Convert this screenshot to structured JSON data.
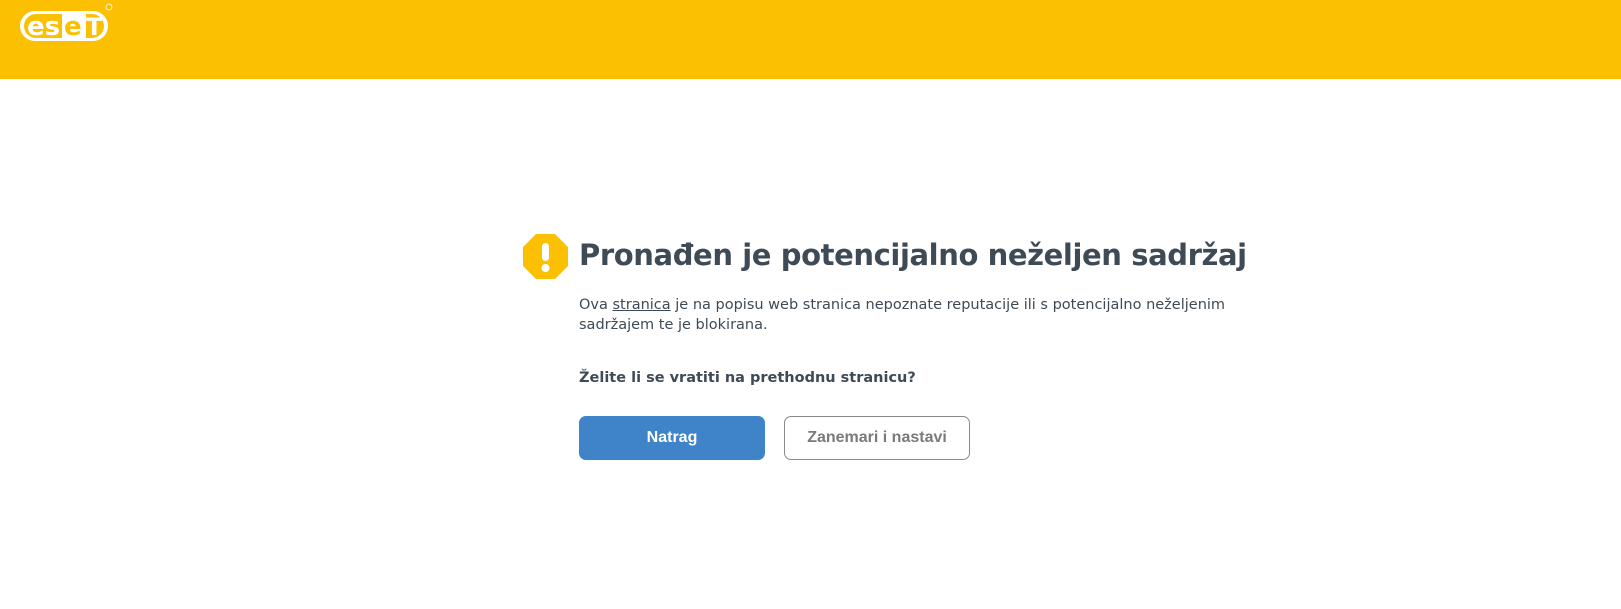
{
  "brand": {
    "logo_text": "eset",
    "registered_mark": "®",
    "accent_color": "#fbc002",
    "logo_icon": "eset-logo"
  },
  "warning": {
    "icon": "exclamation-octagon-icon",
    "icon_color": "#fbc002",
    "title": "Pronađen je potencijalno neželjen sadržaj",
    "desc_before": "Ova ",
    "desc_link": "stranica",
    "desc_after": " je na popisu web stranica nepoznate reputacije ili s potencijalno neželjenim sadržajem te je blokirana.",
    "question": "Želite li se vratiti na prethodnu stranicu?"
  },
  "buttons": {
    "back_label": "Natrag",
    "back_color": "#3f84c8",
    "ignore_label": "Zanemari i nastavi"
  }
}
